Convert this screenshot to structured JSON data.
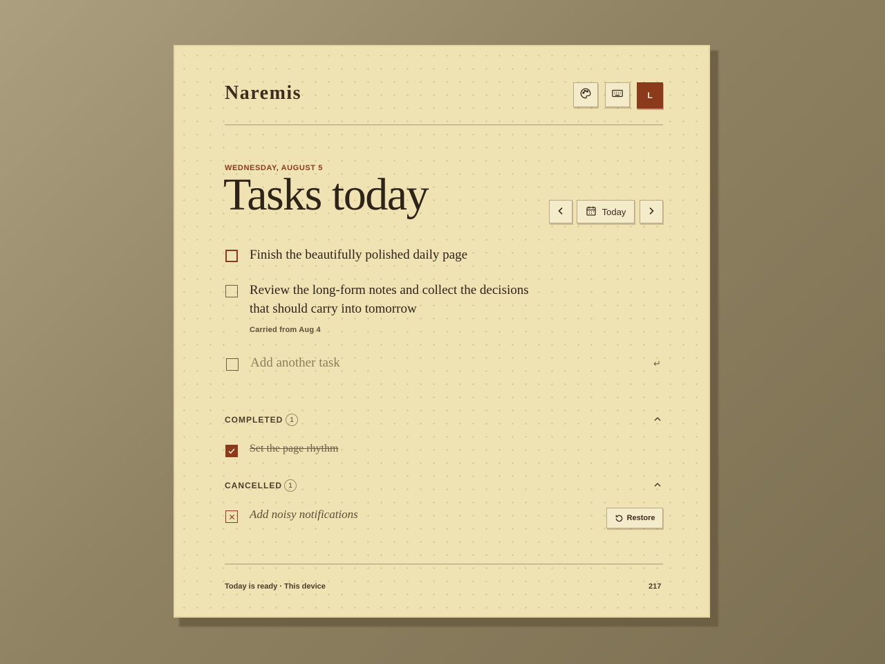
{
  "app": {
    "brand": "Naremis",
    "avatar_initial": "L"
  },
  "header": {
    "icons": {
      "theme": "palette-icon",
      "shortcuts": "keyboard-icon"
    }
  },
  "day": {
    "date_label": "WEDNESDAY, AUGUST 5",
    "title": "Tasks today"
  },
  "nav": {
    "prev_icon": "chevron-left-icon",
    "today_label": "Today",
    "today_icon": "calendar-icon",
    "next_icon": "chevron-right-icon"
  },
  "tasks": [
    {
      "text": "Finish the beautifully polished daily page",
      "meta": ""
    },
    {
      "text_line1": "Review the long-form notes and collect the decisions",
      "text_line2": "that should carry into tomorrow",
      "meta": "Carried from Aug 4"
    }
  ],
  "add_task": {
    "placeholder": "Add another task",
    "enter_hint": "↵"
  },
  "completed": {
    "label": "COMPLETED",
    "count": "1",
    "items": [
      "Set the page rhythm"
    ]
  },
  "cancelled": {
    "label": "CANCELLED",
    "count": "1",
    "items": [
      "Add noisy notifications"
    ],
    "restore_label": "Restore"
  },
  "footer": {
    "status": "Today is ready · This device",
    "count": "217"
  },
  "colors": {
    "accent": "#8b3a1c",
    "paper": "#efe3b3",
    "ink": "#2e2318"
  }
}
